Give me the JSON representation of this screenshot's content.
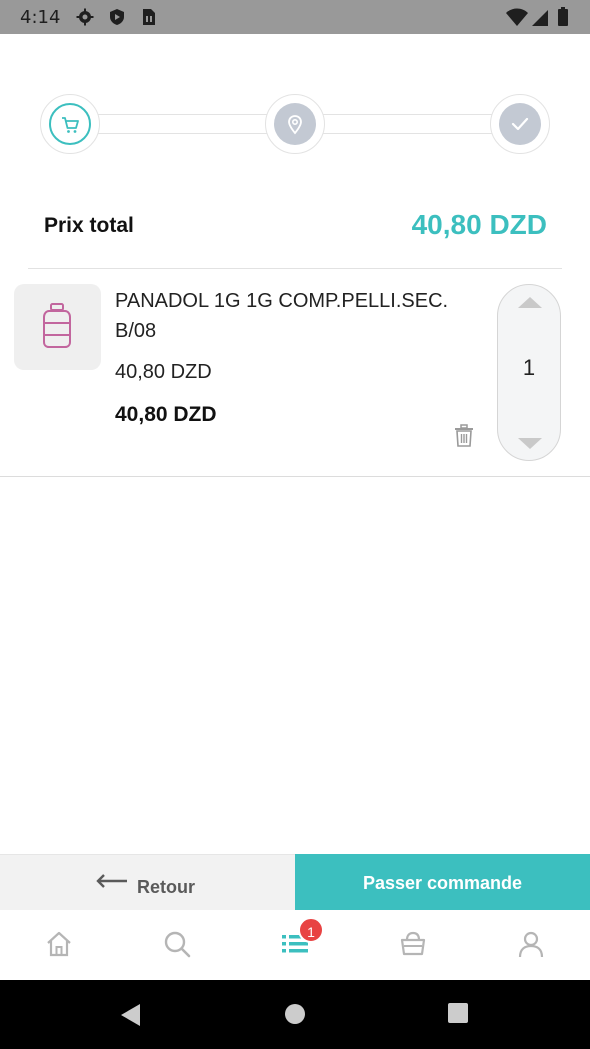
{
  "status_bar": {
    "time": "4:14",
    "icons": [
      "settings-icon",
      "shield-icon",
      "sim-icon",
      "wifi-icon",
      "signal-icon",
      "battery-icon"
    ]
  },
  "checkout_steps": [
    {
      "icon": "cart-icon",
      "state": "active"
    },
    {
      "icon": "location-pin-icon",
      "state": "todo"
    },
    {
      "icon": "check-icon",
      "state": "todo"
    }
  ],
  "summary": {
    "total_label": "Prix total",
    "total_value": "40,80 DZD"
  },
  "cart": {
    "items": [
      {
        "name": "PANADOL 1G 1G COMP.PELLI.SEC. B/08",
        "unit_price": "40,80 DZD",
        "line_total": "40,80 DZD",
        "quantity": "1",
        "thumbnail_icon": "medicine-bottle-icon"
      }
    ]
  },
  "actions": {
    "back_label": "Retour",
    "order_label": "Passer commande"
  },
  "bottom_nav": {
    "items": [
      "home-icon",
      "search-icon",
      "list-icon",
      "basket-icon",
      "user-icon"
    ],
    "active": "list-icon",
    "badge_count": "1"
  },
  "colors": {
    "accent": "#3cbfbf",
    "badge": "#e84343",
    "inactive_step": "#c3c9d3",
    "product_icon": "#c2669e"
  }
}
